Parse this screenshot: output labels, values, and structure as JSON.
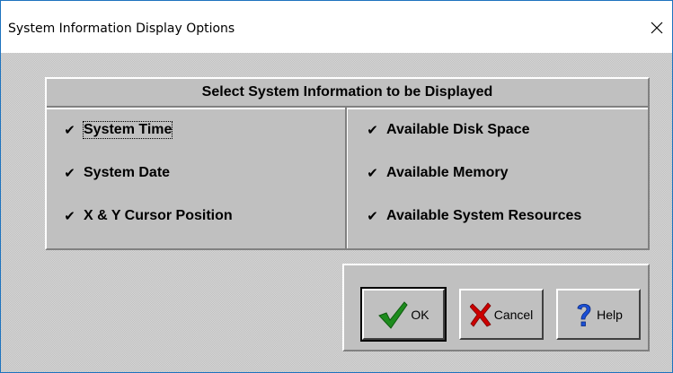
{
  "window": {
    "title": "System Information Display Options"
  },
  "group": {
    "header": "Select System Information to be Displayed",
    "left": [
      {
        "label": "System Time",
        "checked": true,
        "focused": true
      },
      {
        "label": "System Date",
        "checked": true
      },
      {
        "label": "X & Y Cursor Position",
        "checked": true
      }
    ],
    "right": [
      {
        "label": "Available Disk Space",
        "checked": true
      },
      {
        "label": "Available Memory",
        "checked": true
      },
      {
        "label": "Available System Resources",
        "checked": true
      }
    ],
    "check_glyph": "✔"
  },
  "buttons": {
    "ok": "OK",
    "cancel": "Cancel",
    "help": "Help"
  },
  "colors": {
    "face": "#c0c0c0",
    "ok_check": "#1e8c1e",
    "cancel_x": "#cc0000",
    "help_q": "#1a4fd6"
  }
}
